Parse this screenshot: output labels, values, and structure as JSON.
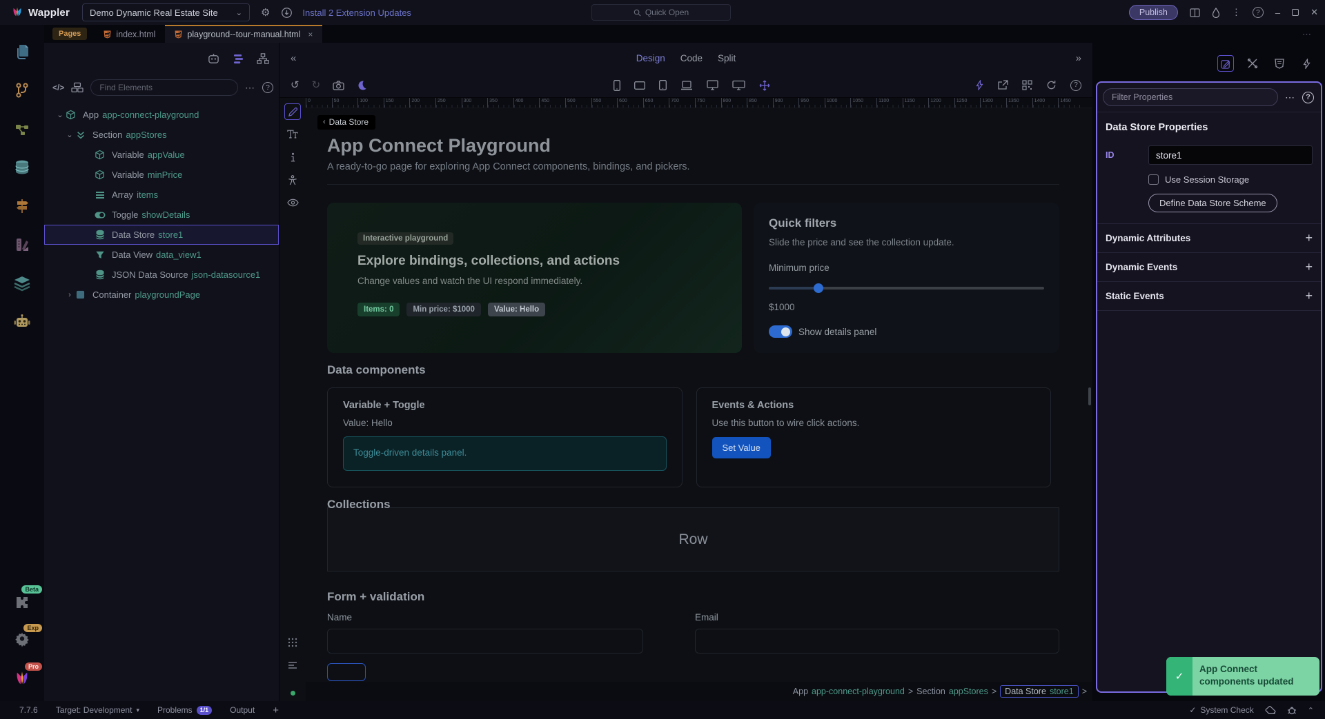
{
  "window": {
    "app_name": "Wappler",
    "project": "Demo Dynamic Real Estate Site",
    "install_updates": "Install 2 Extension Updates",
    "quick_open": "Quick Open",
    "publish": "Publish"
  },
  "tabs": {
    "pages_label": "Pages",
    "files": [
      {
        "name": "index.html"
      },
      {
        "name": "playground--tour-manual.html",
        "active": true,
        "close": "×"
      }
    ]
  },
  "left_panel": {
    "find_placeholder": "Find Elements",
    "tree": [
      {
        "type": "App",
        "name": "app-connect-playground",
        "icon": "cube",
        "caret": "⌄",
        "indent": "ind0"
      },
      {
        "type": "Section",
        "name": "appStores",
        "icon": "section",
        "caret": "⌄",
        "indent": "ind1"
      },
      {
        "type": "Variable",
        "name": "appValue",
        "icon": "cube",
        "caret": "",
        "indent": "ind2"
      },
      {
        "type": "Variable",
        "name": "minPrice",
        "icon": "cube",
        "caret": "",
        "indent": "ind2"
      },
      {
        "type": "Array",
        "name": "items",
        "icon": "bars",
        "caret": "",
        "indent": "ind2"
      },
      {
        "type": "Toggle",
        "name": "showDetails",
        "icon": "toggle",
        "caret": "",
        "indent": "ind2"
      },
      {
        "type": "Data Store",
        "name": "store1",
        "icon": "db",
        "caret": "",
        "indent": "ind2",
        "selected": true
      },
      {
        "type": "Data View",
        "name": "data_view1",
        "icon": "funnel",
        "caret": "",
        "indent": "ind2"
      },
      {
        "type": "JSON Data Source",
        "name": "json-datasource1",
        "icon": "db",
        "caret": "",
        "indent": "ind2"
      },
      {
        "type": "Container",
        "name": "playgroundPage",
        "icon": "square",
        "caret": "›",
        "indent": "ind1"
      }
    ]
  },
  "center": {
    "view_tabs": [
      {
        "label": "Design",
        "active": true
      },
      {
        "label": "Code"
      },
      {
        "label": "Split"
      }
    ],
    "ruler": {
      "start": 0,
      "step": 50,
      "count": 30
    },
    "selected_tag": "Data Store",
    "page": {
      "title": "App Connect Playground",
      "subtitle": "A ready-to-go page for exploring App Connect components, bindings, and pickers.",
      "hero": {
        "chip": "Interactive playground",
        "heading": "Explore bindings, collections, and actions",
        "text": "Change values and watch the UI respond immediately.",
        "badges": [
          {
            "label": "Items: 0",
            "style": "green"
          },
          {
            "label": "Min price: $1000",
            "style": "dark"
          },
          {
            "label": "Value: Hello",
            "style": "gray"
          }
        ]
      },
      "filters": {
        "heading": "Quick filters",
        "text": "Slide the price and see the collection update.",
        "slider_label": "Minimum price",
        "slider_value": "$1000",
        "toggle_label": "Show details panel"
      },
      "data_components": {
        "heading": "Data components",
        "card1": {
          "title": "Variable + Toggle",
          "value": "Value: Hello",
          "info": "Toggle-driven details panel."
        },
        "card2": {
          "title": "Events & Actions",
          "text": "Use this button to wire click actions.",
          "button": "Set Value"
        }
      },
      "collections": {
        "heading": "Collections",
        "row_label": "Row"
      },
      "form": {
        "heading": "Form + validation",
        "fields": [
          {
            "label": "Name",
            "variant": "name-col"
          },
          {
            "label": "Email",
            "variant": "email-col"
          }
        ]
      }
    },
    "breadcrumb": [
      {
        "type": "App",
        "name": "app-connect-playground"
      },
      {
        "type": "Section",
        "name": "appStores"
      },
      {
        "type": "Data Store",
        "name": "store1",
        "boxed": true
      }
    ]
  },
  "right_panel": {
    "filter_placeholder": "Filter Properties",
    "heading": "Data Store Properties",
    "id_label": "ID",
    "id_value": "store1",
    "session_label": "Use Session Storage",
    "scheme_button": "Define Data Store Scheme",
    "sections": [
      {
        "label": "Dynamic Attributes",
        "plus": "+"
      },
      {
        "label": "Dynamic Events",
        "plus": "+"
      },
      {
        "label": "Static Events",
        "plus": "+"
      }
    ]
  },
  "toast": {
    "message": "App Connect components updated"
  },
  "statusbar": {
    "version": "7.7.6",
    "target_label": "Target: Development",
    "problems": "Problems",
    "problems_badge": "1/1",
    "output": "Output",
    "system_check": "System Check"
  },
  "colors": {
    "accent_purple": "#6f63cf",
    "teal_name": "#4f9a8a",
    "tab_orange": "#b97a2c",
    "toast_green": "#7cd3a4",
    "button_blue": "#1353bd"
  }
}
